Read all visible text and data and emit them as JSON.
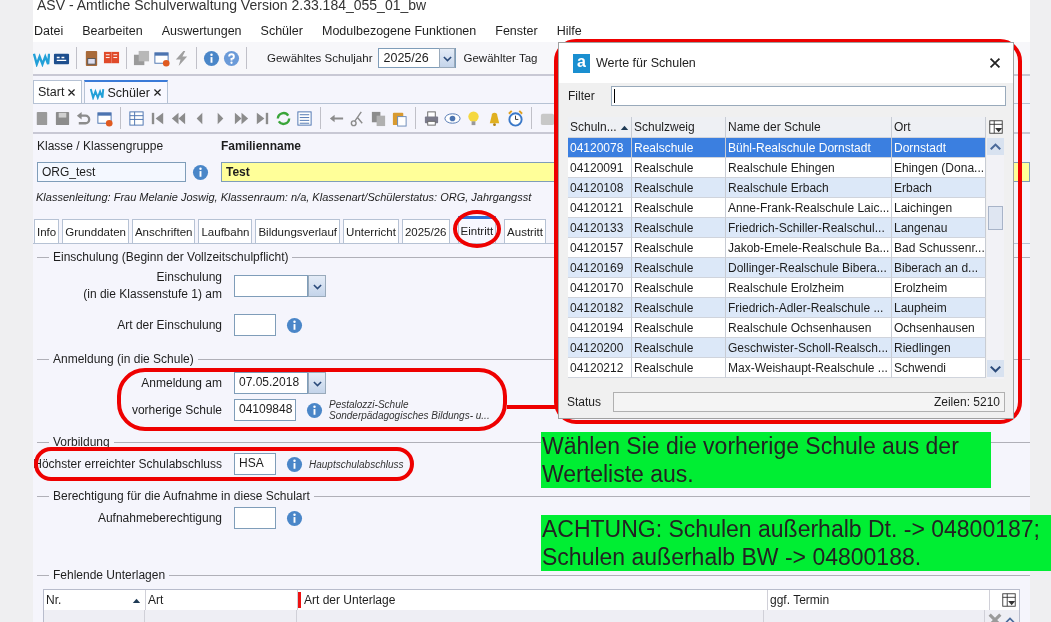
{
  "window": {
    "title": "ASV - Amtliche Schulverwaltung Version 2.33.184_055_01_bw"
  },
  "menu": [
    "Datei",
    "Bearbeiten",
    "Auswertungen",
    "Schüler",
    "Modulbezogene Funktionen",
    "Fenster",
    "Hilfe"
  ],
  "toolbar": {
    "school_year_label": "Gewähltes Schuljahr",
    "school_year": "2025/26",
    "day_label": "Gewählter Tag"
  },
  "doc_tabs": [
    {
      "label": "Start",
      "selected": false
    },
    {
      "label": "Schüler",
      "selected": true
    }
  ],
  "student": {
    "class_label": "Klasse / Klassengruppe",
    "class_value": "ORG_test",
    "surname_label": "Familienname",
    "surname_value": "Test",
    "info_line": "Klassenleitung: Frau Melanie Joswig, Klassenraum: n/a, Klassenart/Schülerstatus: ORG, Jahrgangsst"
  },
  "tabs": [
    {
      "label": "Info",
      "selected": false,
      "circled": false
    },
    {
      "label": "Grunddaten",
      "selected": false,
      "circled": false
    },
    {
      "label": "Anschriften",
      "selected": false,
      "circled": false
    },
    {
      "label": "Laufbahn",
      "selected": false,
      "circled": false
    },
    {
      "label": "Bildungsverlauf",
      "selected": false,
      "circled": false
    },
    {
      "label": "Unterricht",
      "selected": false,
      "circled": false
    },
    {
      "label": "2025/26",
      "selected": false,
      "circled": false
    },
    {
      "label": "Eintritt",
      "selected": true,
      "circled": true
    },
    {
      "label": "Austritt",
      "selected": false,
      "circled": false
    }
  ],
  "sections": [
    {
      "title": "Einschulung (Beginn der Vollzeitschulpflicht)",
      "circled": false,
      "fields": [
        {
          "kind": "date",
          "label": "Einschulung\n(in die Klassenstufe 1) am",
          "circled": false
        },
        {
          "kind": "code",
          "label": "Art der Einschulung",
          "circled": false
        }
      ]
    },
    {
      "title": "Anmeldung (in die Schule)",
      "circled": true,
      "fields": [
        {
          "kind": "date",
          "label": "Anmeldung am",
          "value": "07.05.2018",
          "circled": false
        },
        {
          "kind": "school",
          "label": "vorherige Schule",
          "value": "04109848",
          "note_lines": [
            "Pestalozzi-Schule",
            "Sonderpädagogisches Bildungs- u..."
          ],
          "circled": false
        }
      ]
    },
    {
      "title": "Vorbildung",
      "circled": false,
      "fields": [
        {
          "kind": "code",
          "label": "Höchster erreichter Schulabschluss",
          "value": "HSA",
          "note_lines": [
            "Hauptschulabschluss"
          ],
          "circled": true
        }
      ]
    },
    {
      "title": "Berechtigung für die Aufnahme in diese Schulart",
      "circled": false,
      "fields": [
        {
          "kind": "code",
          "label": "Aufnahmeberechtigung",
          "circled": false
        }
      ]
    },
    {
      "title": "Fehlende Unterlagen",
      "circled": false
    }
  ],
  "documents_table": {
    "columns": [
      {
        "label": "Nr.",
        "sorted": true,
        "marked": false
      },
      {
        "label": "Art",
        "sorted": false,
        "marked": false
      },
      {
        "label": "Art der Unterlage",
        "sorted": false,
        "marked": true
      },
      {
        "label": "ggf. Termin",
        "sorted": false,
        "marked": false
      }
    ]
  },
  "dialog": {
    "logo": "a",
    "title": "Werte für Schulen",
    "circled": true,
    "filter_label": "Filter",
    "columns": [
      {
        "label": "Schuln...",
        "sorted": true
      },
      {
        "label": "Schulzweig",
        "sorted": false
      },
      {
        "label": "Name der Schule",
        "sorted": false
      },
      {
        "label": "Ort",
        "sorted": false
      }
    ],
    "rows": [
      {
        "cells": [
          "04120078",
          "Realschule",
          "Bühl-Realschule Dornstadt",
          "Dornstadt"
        ],
        "selected": true
      },
      {
        "cells": [
          "04120091",
          "Realschule",
          "Realschule Ehingen",
          "Ehingen (Dona..."
        ],
        "selected": false
      },
      {
        "cells": [
          "04120108",
          "Realschule",
          "Realschule Erbach",
          "Erbach"
        ],
        "selected": false
      },
      {
        "cells": [
          "04120121",
          "Realschule",
          "Anne-Frank-Realschule Laic...",
          "Laichingen"
        ],
        "selected": false
      },
      {
        "cells": [
          "04120133",
          "Realschule",
          "Friedrich-Schiller-Realschul...",
          "Langenau"
        ],
        "selected": false
      },
      {
        "cells": [
          "04120157",
          "Realschule",
          "Jakob-Emele-Realschule Ba...",
          "Bad Schussenr..."
        ],
        "selected": false
      },
      {
        "cells": [
          "04120169",
          "Realschule",
          "Dollinger-Realschule Bibera...",
          "Biberach an d..."
        ],
        "selected": false
      },
      {
        "cells": [
          "04120170",
          "Realschule",
          "Realschule Erolzheim",
          "Erolzheim"
        ],
        "selected": false
      },
      {
        "cells": [
          "04120182",
          "Realschule",
          "Friedrich-Adler-Realschule ...",
          "Laupheim"
        ],
        "selected": false
      },
      {
        "cells": [
          "04120194",
          "Realschule",
          "Realschule Ochsenhausen",
          "Ochsenhausen"
        ],
        "selected": false
      },
      {
        "cells": [
          "04120200",
          "Realschule",
          "Geschwister-Scholl-Realsch...",
          "Riedlingen"
        ],
        "selected": false
      },
      {
        "cells": [
          "04120212",
          "Realschule",
          "Max-Weishaupt-Realschule ...",
          "Schwendi"
        ],
        "selected": false
      }
    ],
    "status_label": "Status",
    "row_count": "Zeilen: 5210"
  },
  "notes": [
    "Wählen Sie die vorherige Schule aus der Werteliste aus.",
    "ACHTUNG: Schulen außerhalb Dt. -> 04800187; Schulen außerhalb BW -> 04800188."
  ]
}
